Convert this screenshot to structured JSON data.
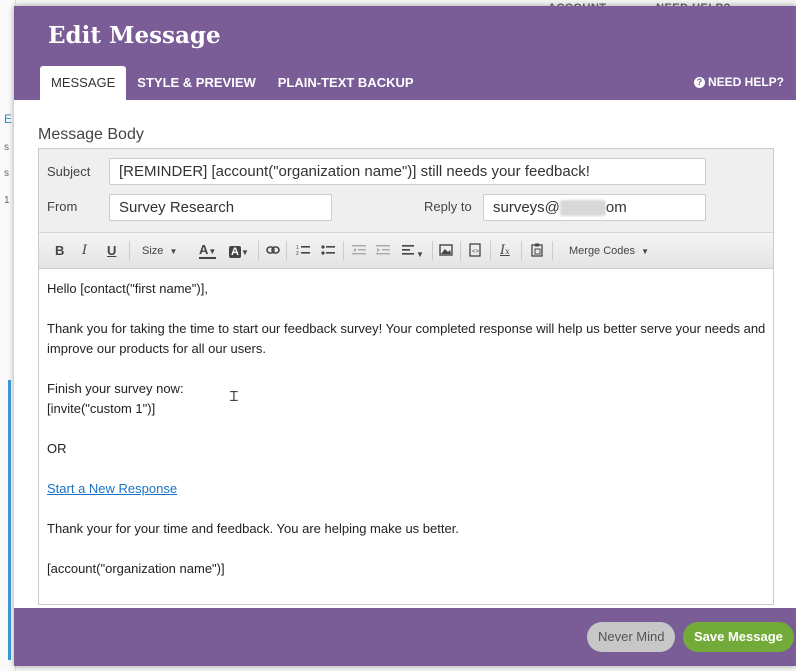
{
  "background": {
    "nav_account": "ACCOUNT",
    "nav_help": "NEED HELP?",
    "side_letters": [
      "E",
      "s",
      "s",
      "1"
    ]
  },
  "modal": {
    "title": "Edit Message",
    "tabs": [
      {
        "label": "MESSAGE",
        "active": true
      },
      {
        "label": "STYLE & PREVIEW",
        "active": false
      },
      {
        "label": "PLAIN-TEXT BACKUP",
        "active": false
      }
    ],
    "need_help": "NEED HELP?",
    "section_title": "Message Body"
  },
  "fields": {
    "subject_label": "Subject",
    "subject_value": "[REMINDER] [account(\"organization name\")] still needs your feedback!",
    "from_label": "From",
    "from_value": "Survey Research",
    "reply_label": "Reply to",
    "reply_prefix": "surveys@",
    "reply_suffix": "om"
  },
  "toolbar": {
    "bold": "B",
    "italic": "I",
    "underline": "U",
    "size": "Size",
    "font_color": "A",
    "bg_color": "A",
    "merge_codes": "Merge Codes",
    "clear_format": "I"
  },
  "body": {
    "greeting": "Hello [contact(\"first name\")],",
    "para1": "Thank you for taking the time to start our feedback survey! Your completed response will help us better serve your needs and improve our products for all our users.",
    "finish_line": "Finish your survey now:",
    "invite_code": "[invite(\"custom 1\")]",
    "or": "OR",
    "link": "Start a New Response",
    "thanks": "Thank your for your time and feedback. You are helping make us better.",
    "signature": "[account(\"organization name\")]"
  },
  "footer": {
    "never_mind": "Never Mind",
    "save": "Save Message"
  },
  "colors": {
    "header": "#7a5c96",
    "save_button": "#73ab3a",
    "link": "#1a73c8"
  }
}
